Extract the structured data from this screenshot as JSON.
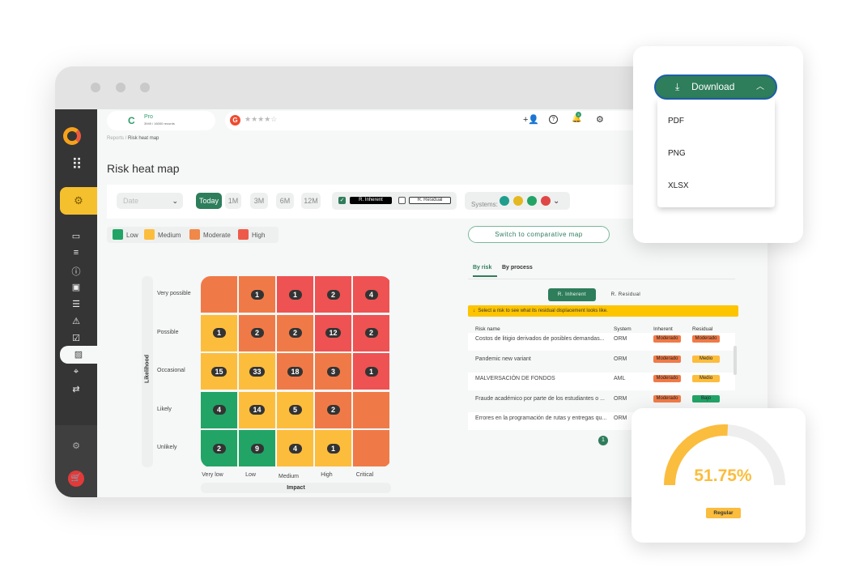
{
  "colors": {
    "low": "#22a466",
    "medium": "#fdbd3c",
    "moderate": "#f07a47",
    "high": "#ee5252",
    "accent": "#2e7d5b"
  },
  "topbar": {
    "plan": "Pro",
    "records": "3949 / 16000 records",
    "rating_icon": "g2-logo",
    "stars": "★★★★☆"
  },
  "header_icons": [
    "add-user-icon",
    "help-icon",
    "bell-icon",
    "gear-icon"
  ],
  "notification_count": "3",
  "breadcrumb": {
    "parent": "Reports",
    "current": "Risk heat map"
  },
  "page_title": "Risk heat map",
  "filters": {
    "date_placeholder": "Date",
    "periods": [
      "Today",
      "1M",
      "3M",
      "6M",
      "12M"
    ],
    "selected_period": "Today",
    "inherent": "R. Inherent",
    "inherent_checked": true,
    "residual": "R. Residual",
    "residual_checked": false,
    "systems_label": "Systems:"
  },
  "legend": [
    "Low",
    "Medium",
    "Moderate",
    "High"
  ],
  "switch_button": "Switch to comparative map",
  "heatmap": {
    "y_title": "Likelihood",
    "x_title": "Impact",
    "rows": [
      "Very possible",
      "Possible",
      "Occasional",
      "Likely",
      "Unlikely"
    ],
    "cols": [
      "Very low",
      "Low",
      "Medium",
      "High",
      "Critical"
    ],
    "levels": [
      [
        "moderate",
        "moderate",
        "high",
        "high",
        "high"
      ],
      [
        "medium",
        "moderate",
        "moderate",
        "high",
        "high"
      ],
      [
        "medium",
        "medium",
        "moderate",
        "moderate",
        "high"
      ],
      [
        "low",
        "medium",
        "medium",
        "moderate",
        "moderate"
      ],
      [
        "low",
        "low",
        "medium",
        "medium",
        "moderate"
      ]
    ],
    "counts": [
      [
        "",
        "1",
        "1",
        "2",
        "4"
      ],
      [
        "1",
        "2",
        "2",
        "12",
        "2"
      ],
      [
        "15",
        "33",
        "18",
        "3",
        "1"
      ],
      [
        "4",
        "14",
        "5",
        "2",
        ""
      ],
      [
        "2",
        "9",
        "4",
        "1",
        ""
      ]
    ]
  },
  "tabs": {
    "by_risk": "By risk",
    "by_process": "By process"
  },
  "toggle": {
    "inherent": "R. Inherent",
    "residual": "R. Residual"
  },
  "hint": "Select a risk to see what its residual displacement looks like.",
  "table": {
    "headers": [
      "Risk name",
      "System",
      "Inherent",
      "Residual"
    ],
    "rows": [
      {
        "name": "Costos de litigio derivados de posibles demandas...",
        "system": "ORM",
        "inherent": "Moderado",
        "inherent_level": "moderate",
        "residual": "Moderado",
        "residual_level": "moderate"
      },
      {
        "name": "Pandemic new variant",
        "system": "ORM",
        "inherent": "Moderado",
        "inherent_level": "moderate",
        "residual": "Medio",
        "residual_level": "medium"
      },
      {
        "name": "MALVERSACIÓN DE FONDOS",
        "system": "AML",
        "inherent": "Moderado",
        "inherent_level": "moderate",
        "residual": "Medio",
        "residual_level": "medium"
      },
      {
        "name": "Fraude académico por parte de los estudiantes o ...",
        "system": "ORM",
        "inherent": "Moderado",
        "inherent_level": "moderate",
        "residual": "Bajo",
        "residual_level": "low"
      },
      {
        "name": "Errores en la programación de rutas y entregas qu...",
        "system": "ORM",
        "inherent": "",
        "inherent_level": "",
        "residual": "",
        "residual_level": ""
      }
    ],
    "page": "1"
  },
  "download": {
    "label": "Download",
    "options": [
      "PDF",
      "PNG",
      "XLSX"
    ]
  },
  "gauge": {
    "value_percent": 51.75,
    "label": "51.75%",
    "status": "Regular"
  }
}
